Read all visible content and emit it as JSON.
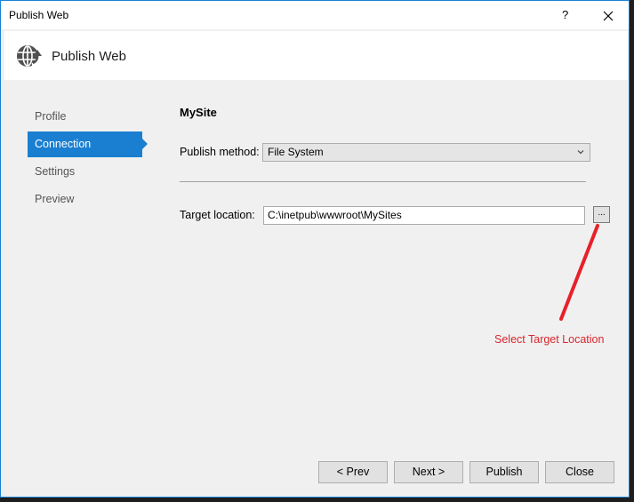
{
  "window": {
    "title": "Publish Web",
    "help_label": "?",
    "close_icon": "close-icon"
  },
  "header": {
    "icon": "globe-publish-icon",
    "title": "Publish Web"
  },
  "nav": {
    "items": [
      {
        "label": "Profile",
        "active": false
      },
      {
        "label": "Connection",
        "active": true
      },
      {
        "label": "Settings",
        "active": false
      },
      {
        "label": "Preview",
        "active": false
      }
    ]
  },
  "main": {
    "site_name": "MySite",
    "publish_method": {
      "label": "Publish method:",
      "value": "File System"
    },
    "target_location": {
      "label": "Target location:",
      "value": "C:\\inetpub\\wwwroot\\MySites",
      "browse_label": "..."
    }
  },
  "annotation": {
    "text": "Select Target Location",
    "color": "#d8262f"
  },
  "footer": {
    "prev_label": "< Prev",
    "next_label": "Next >",
    "publish_label": "Publish",
    "close_label": "Close"
  },
  "colors": {
    "accent": "#1a7fd1",
    "window_border": "#1883d7"
  }
}
